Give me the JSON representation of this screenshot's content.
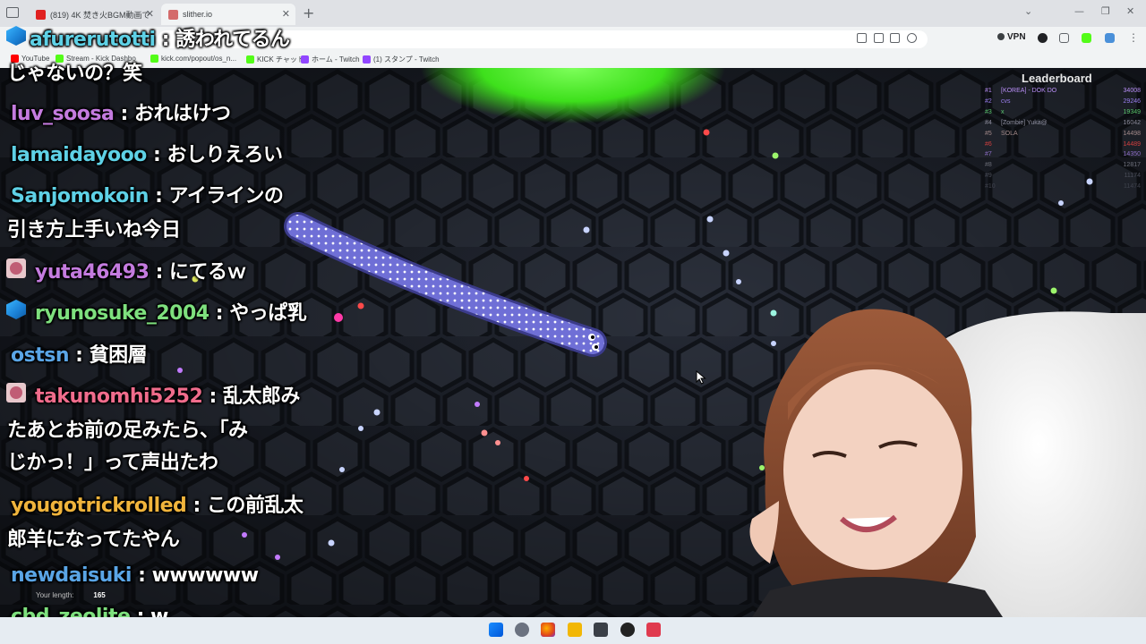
{
  "browser": {
    "tabs": [
      {
        "label": "(819) 4K 焚き火BGM動画で"
      },
      {
        "label": "slither.io"
      }
    ],
    "bookmarks": [
      {
        "label": "YouTube",
        "color": "#ff0000"
      },
      {
        "label": "Stream - Kick Dashbo",
        "color": "#53fc18"
      },
      {
        "label": "kick.com/popout/os_n...",
        "color": "#53fc18"
      },
      {
        "label": "KICK チャット",
        "color": "#53fc18"
      },
      {
        "label": "ホーム - Twitch",
        "color": "#9146ff"
      },
      {
        "label": "(1) スタンプ - Twitch",
        "color": "#9146ff"
      }
    ],
    "vpn_label": "VPN"
  },
  "game": {
    "leaderboard_title": "Leaderboard",
    "leaderboard": [
      {
        "rank": "#1",
        "name": "[KOREA] - DOK DO",
        "score": "34008",
        "color": "#b98ef7"
      },
      {
        "rank": "#2",
        "name": "cvs",
        "score": "29246",
        "color": "#9a7ef0"
      },
      {
        "rank": "#3",
        "name": "x",
        "score": "19349",
        "color": "#59c46c"
      },
      {
        "rank": "#4",
        "name": "[Zombie] Yuka@",
        "score": "16042",
        "color": "#8c8c9c"
      },
      {
        "rank": "#5",
        "name": "SOLA",
        "score": "14498",
        "color": "#a38a8a"
      },
      {
        "rank": "#6",
        "name": "",
        "score": "14489",
        "color": "#d13f3f"
      },
      {
        "rank": "#7",
        "name": "",
        "score": "14350",
        "color": "#8c6dc6"
      },
      {
        "rank": "#8",
        "name": "",
        "score": "12817",
        "color": "#6d6f7a"
      },
      {
        "rank": "#9",
        "name": "",
        "score": "11174",
        "color": "#4b4e5a"
      },
      {
        "rank": "#10",
        "name": "",
        "score": "11474",
        "color": "#3f424d"
      }
    ],
    "your_length_label": "Your length:",
    "your_length_value": "165"
  },
  "chat": [
    {
      "user": "afurerutotti",
      "sep": " : ",
      "text": "誘われてるん",
      "cont": "じゃないの？笑",
      "color": "#5ed1e6",
      "badge": "cube"
    },
    {
      "user": "luv_soosa",
      "sep": " : ",
      "text": "おれはけつ",
      "cont": "",
      "color": "#c47bdf",
      "badge": ""
    },
    {
      "user": "lamaidayooo",
      "sep": " : ",
      "text": "おしりえろい",
      "cont": "",
      "color": "#5ed1e6",
      "badge": ""
    },
    {
      "user": "Sanjomokoin",
      "sep": " : ",
      "text": "アイラインの",
      "cont": "引き方上手いね今日",
      "color": "#5ed1e6",
      "badge": ""
    },
    {
      "user": "yuta46493",
      "sep": " : ",
      "text": "にてるｗ",
      "cont": "",
      "color": "#c47bdf",
      "badge": "avatar"
    },
    {
      "user": "ryunosuke_2004",
      "sep": " : ",
      "text": "やっぱ乳",
      "cont": "",
      "color": "#7ee07e",
      "badge": "cube"
    },
    {
      "user": "ostsn",
      "sep": " : ",
      "text": "貧困層",
      "cont": "",
      "color": "#5aa5e6",
      "badge": ""
    },
    {
      "user": "takunomhi5252",
      "sep": " : ",
      "text": "乱太郎み",
      "cont": "たあとお前の足みたら、「み",
      "cont2": "じかっ！」って声出たわ",
      "color": "#f06c8c",
      "badge": "avatar"
    },
    {
      "user": "yougotrickrolled",
      "sep": " : ",
      "text": "この前乱太",
      "cont": "郎羊になってたやん",
      "color": "#f0b43c",
      "badge": ""
    },
    {
      "user": "newdaisuki",
      "sep": " : ",
      "text": "wwwwww",
      "cont": "",
      "color": "#5aa5e6",
      "badge": ""
    },
    {
      "user": "cbd_zeolite",
      "sep": " : ",
      "text": "w",
      "cont": "",
      "color": "#7ee07e",
      "badge": ""
    }
  ]
}
